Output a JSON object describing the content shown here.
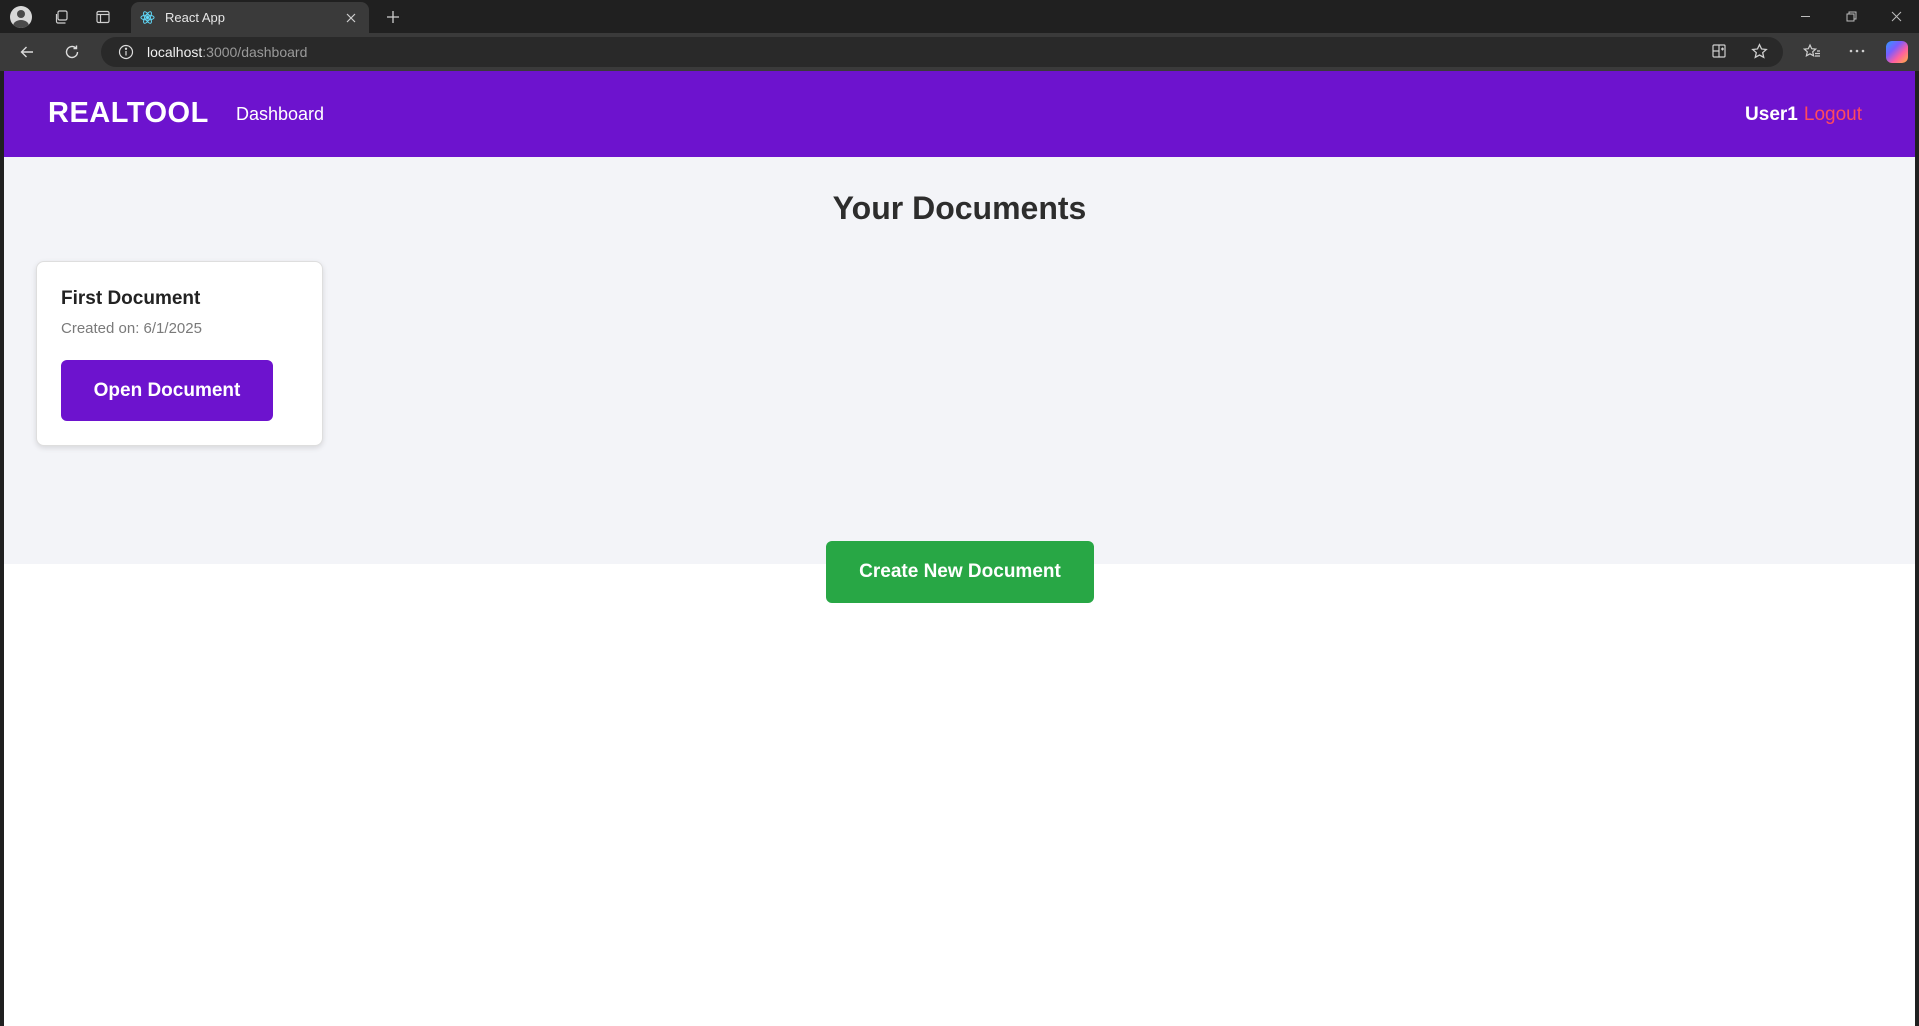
{
  "browser": {
    "tab_title": "React App",
    "url_host": "localhost",
    "url_path": ":3000/dashboard",
    "icons": {
      "profile": "profile-icon",
      "workspaces": "workspaces-icon",
      "vertical_tabs": "vertical-tabs-icon",
      "favicon": "react-icon",
      "tab_close": "close-icon",
      "new_tab": "plus-icon",
      "back": "back-arrow-icon",
      "refresh": "refresh-icon",
      "site_info": "info-icon",
      "app_available": "app-install-icon",
      "favorite": "star-icon",
      "favorites": "favorites-icon",
      "more": "more-icon",
      "copilot": "copilot-icon",
      "minimize": "minimize-icon",
      "restore": "restore-icon",
      "close_window": "close-window-icon"
    }
  },
  "navbar": {
    "brand": "REALTOOL",
    "link": "Dashboard",
    "username": "User1",
    "logout": "Logout",
    "color": "#6d13ce",
    "logout_color": "#ff4b5c"
  },
  "main": {
    "heading": "Your Documents",
    "documents": [
      {
        "title": "First Document",
        "created": "Created on: 6/1/2025",
        "open_label": "Open Document"
      }
    ],
    "create_label": "Create New Document",
    "create_color": "#28a745"
  }
}
